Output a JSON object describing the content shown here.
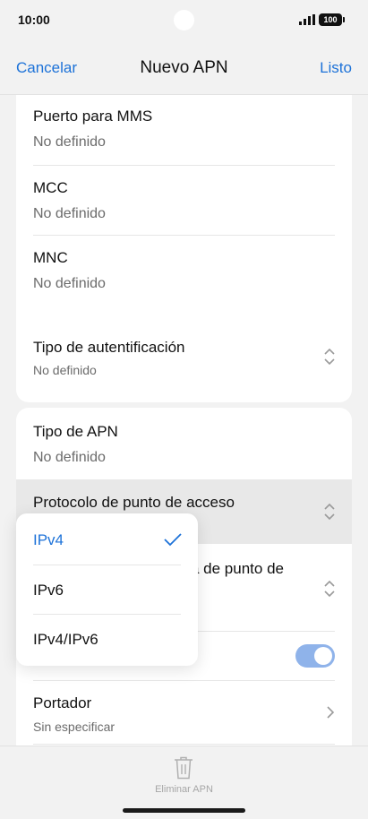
{
  "status": {
    "time": "10:00",
    "battery": "100"
  },
  "nav": {
    "cancel": "Cancelar",
    "title": "Nuevo APN",
    "done": "Listo"
  },
  "fields": {
    "mms_port": {
      "title": "Puerto para MMS",
      "value": "No definido"
    },
    "mcc": {
      "title": "MCC",
      "value": "No definido"
    },
    "mnc": {
      "title": "MNC",
      "value": "No definido"
    },
    "auth_type": {
      "title": "Tipo de autentificación",
      "value": "No definido"
    },
    "apn_type": {
      "title": "Tipo de APN",
      "value": "No definido"
    },
    "apn_protocol": {
      "title": "Protocolo de punto de acceso"
    },
    "roaming_protocol": {
      "title_partial": "a de punto de"
    },
    "carrier": {
      "title": "Portador",
      "value": "Sin especificar"
    }
  },
  "dropdown": {
    "options": [
      {
        "label": "IPv4",
        "selected": true
      },
      {
        "label": "IPv6",
        "selected": false
      },
      {
        "label": "IPv4/IPv6",
        "selected": false
      }
    ]
  },
  "toggle": {
    "on": true
  },
  "bottom": {
    "delete_label": "Eliminar APN"
  },
  "colors": {
    "accent": "#1d72d8",
    "toggle_on": "#8fb3ea"
  }
}
